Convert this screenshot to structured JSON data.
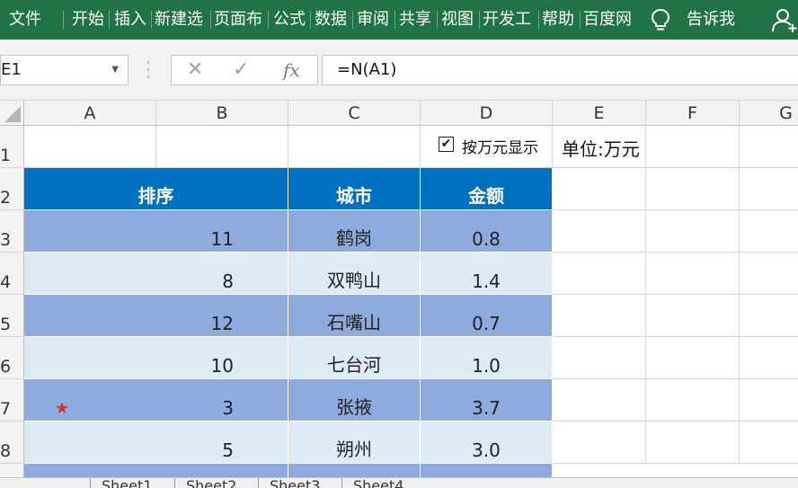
{
  "ribbon": {
    "tabs": [
      "文件",
      "开始",
      "插入",
      "新建选",
      "页面布",
      "公式",
      "数据",
      "审阅",
      "共享",
      "视图",
      "开发工",
      "帮助",
      "百度网"
    ],
    "tell_me": "告诉我",
    "icons": [
      "lightbulb-icon",
      "add-person-icon"
    ]
  },
  "formula_bar": {
    "name_box": "E1",
    "cancel_icon": "✕",
    "enter_icon": "✓",
    "fx_label": "fx",
    "formula": "=N(A1)"
  },
  "columns": [
    "A",
    "B",
    "C",
    "D",
    "E",
    "F",
    "G"
  ],
  "rows": [
    "1",
    "2",
    "3",
    "4",
    "5",
    "6",
    "7",
    "8"
  ],
  "checkbox": {
    "label": "按万元显示",
    "checked": true,
    "mark": "✔"
  },
  "unit_label": "单位:万元",
  "table": {
    "headers": {
      "rank": "排序",
      "city": "城市",
      "amount": "金额"
    },
    "rows": [
      {
        "rank": "11",
        "city": "鹤岗",
        "amount": "0.8",
        "star": ""
      },
      {
        "rank": "8",
        "city": "双鸭山",
        "amount": "1.4",
        "star": ""
      },
      {
        "rank": "12",
        "city": "石嘴山",
        "amount": "0.7",
        "star": ""
      },
      {
        "rank": "10",
        "city": "七台河",
        "amount": "1.0",
        "star": ""
      },
      {
        "rank": "3",
        "city": "张掖",
        "amount": "3.7",
        "star": "★"
      },
      {
        "rank": "5",
        "city": "朔州",
        "amount": "3.0",
        "star": ""
      }
    ]
  },
  "sheet_tabs": [
    "Sheet1",
    "Sheet2",
    "Sheet3",
    "Sheet4"
  ],
  "colors": {
    "ribbon": "#217346",
    "header_fill": "#0070c0",
    "band_dark": "#8faadc",
    "band_light": "#ddebf7",
    "star": "#c0392b"
  }
}
